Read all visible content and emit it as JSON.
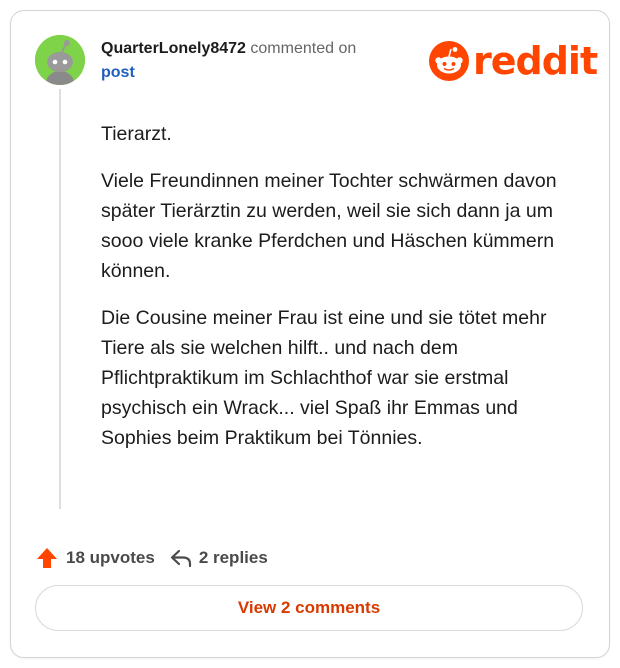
{
  "comment": {
    "author": "QuarterLonely8472",
    "action_text": "commented on",
    "target": "post",
    "paragraphs": [
      "Tierarzt.",
      "Viele Freundinnen meiner Tochter schwärmen davon später Tierärztin zu werden, weil sie sich dann ja um sooo viele kranke Pferdchen und Häschen kümmern können.",
      "Die Cousine meiner Frau ist eine und sie tötet mehr Tiere als sie welchen hilft.. und nach dem Pflichtpraktikum im Schlachthof war sie erstmal psychisch ein Wrack... viel Spaß ihr Emmas und Sophies beim Praktikum bei Tönnies."
    ]
  },
  "brand": {
    "logo_text": "reddit",
    "color": "#ff4500"
  },
  "footer": {
    "upvotes": "18 upvotes",
    "replies": "2 replies",
    "view_button": "View 2 comments"
  },
  "colors": {
    "accent": "#ff4500",
    "link": "#1f5fbd",
    "avatar_bg": "#7ed348",
    "button_text": "#d93a00"
  },
  "icons": [
    "snoo-avatar-icon",
    "reddit-logo-icon",
    "upvote-arrow-icon",
    "reply-icon"
  ]
}
